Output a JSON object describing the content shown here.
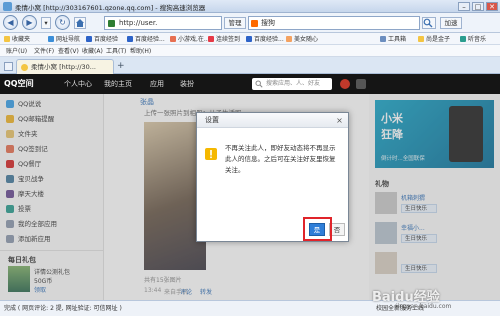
{
  "window": {
    "title": "柔情小窝 [http://303167601.qzone.qq.com] - 搜狗高速浏览器",
    "minimize": "–",
    "maximize": "□",
    "close": "✕"
  },
  "nav": {
    "back": "◀",
    "forward": "▶",
    "refresh": "↻",
    "dropdown": "▾",
    "url": "http://user.",
    "buttons": [
      "管理",
      "",
      "加速",
      ""
    ],
    "search_placeholder": "搜狗",
    "search_icon": "search-icon"
  },
  "favorites": [
    {
      "label": "收藏夹"
    },
    {
      "label": "网址导航"
    },
    {
      "label": "百度经验"
    },
    {
      "label": "百度经验..."
    },
    {
      "label": "小游戏,在..."
    },
    {
      "label": "连续签到"
    },
    {
      "label": "百度经验..."
    },
    {
      "label": "美女随心"
    },
    {
      "label": "工具箱"
    },
    {
      "label": "尚是金子"
    },
    {
      "label": "听音乐"
    }
  ],
  "menu": [
    "账户(U)",
    "文件(F)",
    "查看(V)",
    "收藏(A)",
    "工具(T)",
    "帮助(H)"
  ],
  "tab": {
    "label": "柔情小窝 [http://30..."
  },
  "qzone": {
    "logo": "QQ空间",
    "menus": [
      "个人中心",
      "我的主页",
      "应用",
      "装扮"
    ],
    "search_placeholder": "搜索应用、人、好友"
  },
  "sidebar": {
    "items": [
      {
        "label": "QQ说说"
      },
      {
        "label": "QQ邮箱提醒"
      },
      {
        "label": "文件夹"
      },
      {
        "label": "QQ签到记"
      },
      {
        "label": "QQ餐厅"
      },
      {
        "label": "宝贝战争"
      },
      {
        "label": "摩天大楼"
      },
      {
        "label": "投票"
      },
      {
        "label": "我的全部应用"
      },
      {
        "label": "添加新应用"
      }
    ],
    "gift_title": "每日礼包",
    "gift_app": "详情公测礼包",
    "gift_count": "50G币",
    "gift_link": "领取"
  },
  "center": {
    "author": "张晶",
    "prev_photo": "上传一张照片到相册：儿子生活照",
    "photo_caption": "共有15张图片",
    "time": "13:44",
    "actions": [
      "来自手机",
      "评论",
      "转发"
    ]
  },
  "rightpanel": {
    "banner_line1": "小米",
    "banner_line2": "狂降",
    "banner_sub": "倒计时...全国联保",
    "section_title": "礼物",
    "friend1": "机箱刺猬",
    "friend1_action": "生日快乐",
    "friend2": "幸福小...",
    "friend2_action": "生日快乐",
    "friend3_action": "生日快乐"
  },
  "dialog": {
    "title": "设置",
    "close": "×",
    "message": "不再关注此人，即好友动态将不再显示此人的信息。之后可在关注好友里恢复关注。",
    "ok": "是",
    "cancel": "否"
  },
  "status": {
    "left": "完成 ( 网页评论: 2 提, 网址验证: 可信网址 )",
    "right": "校园全新服务上线",
    "watermark": "Baidu经验",
    "watermark_url": "jingyan.baidu.com"
  }
}
